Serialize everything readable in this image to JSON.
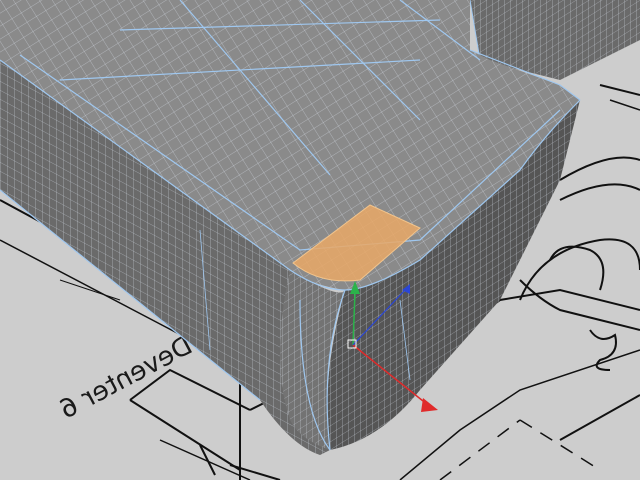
{
  "viewport": {
    "mode": "perspective",
    "selection": "face",
    "blueprint_label": "Deventer 6"
  },
  "colors": {
    "background": "#c9c9c9",
    "blueprint_line": "#111111",
    "mesh_face_top": "#8a8a8a",
    "mesh_face_side": "#5e5e5e",
    "mesh_face_front": "#6a6a6a",
    "wire_minor": "#d6dce6",
    "wire_major": "#9fc7ef",
    "selected_face": "#e9a866",
    "axis_x": "#e02a2a",
    "axis_y": "#2bb34a",
    "axis_z": "#2a46d6"
  },
  "gizmo": {
    "axes": [
      "x",
      "y",
      "z"
    ],
    "icon": "move-gizmo-icon"
  }
}
